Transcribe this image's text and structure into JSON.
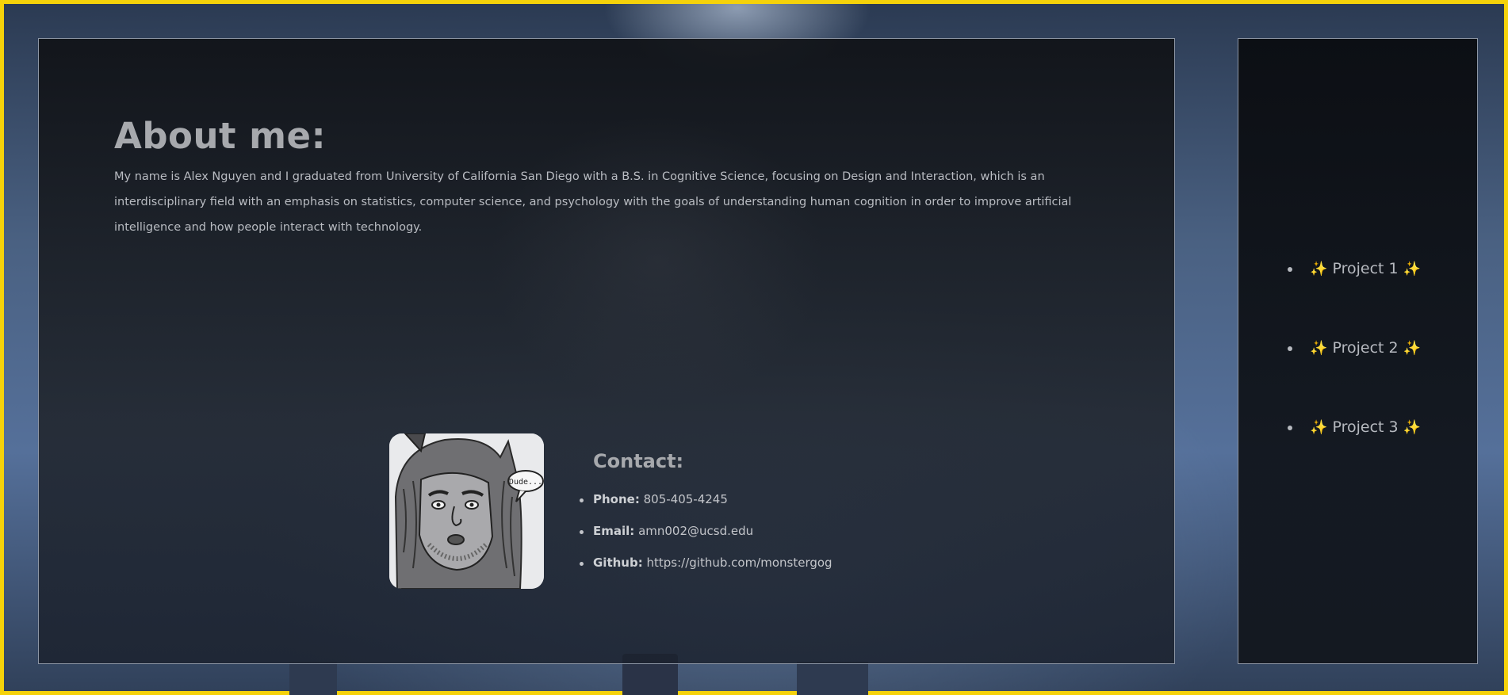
{
  "about": {
    "title": "About me:",
    "text": "My name is Alex Nguyen and I graduated from University of California San Diego with a B.S. in Cognitive Science, focusing on Design and Interaction, which is an interdisciplinary field with an emphasis on statistics, computer science, and psychology with the goals of understanding human cognition in order to improve artificial intelligence and how people interact with technology."
  },
  "avatar": {
    "speech_bubble": "Dude..."
  },
  "contact": {
    "title": "Contact:",
    "items": [
      {
        "label": "Phone:",
        "value": "805-405-4245"
      },
      {
        "label": "Email:",
        "value": "amn002@ucsd.edu"
      },
      {
        "label": "Github:",
        "value": "https://github.com/monstergog"
      }
    ]
  },
  "projects": {
    "sparkle": "✨",
    "items": [
      {
        "label": "Project 1"
      },
      {
        "label": "Project 2"
      },
      {
        "label": "Project 3"
      }
    ]
  },
  "colors": {
    "frame_border": "#f5d20a",
    "panel_border": "#8d96a5",
    "heading_text": "#a7a9ad",
    "sparkle": "#f3c623"
  }
}
